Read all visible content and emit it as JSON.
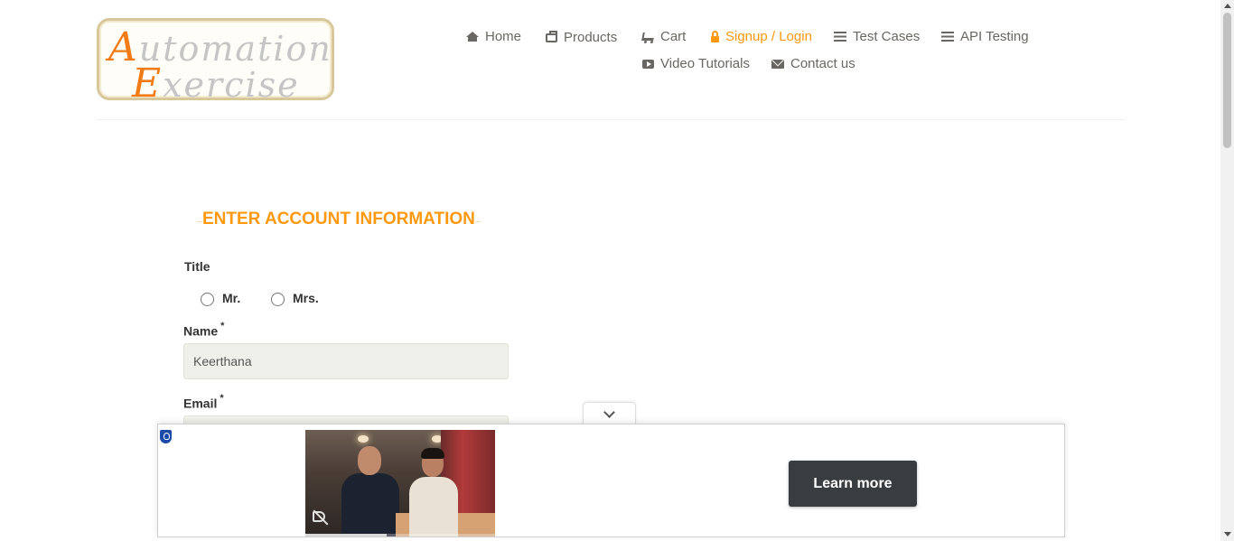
{
  "logo": {
    "line1_cap": "A",
    "line1_rest": "utomation",
    "line2_cap": "E",
    "line2_rest": "xercise"
  },
  "nav": {
    "home": "Home",
    "products": "Products",
    "cart": "Cart",
    "signup_login": "Signup / Login",
    "test_cases": "Test Cases",
    "api_testing": "API Testing",
    "video_tutorials": "Video Tutorials",
    "contact_us": "Contact us",
    "active_item": "signup_login",
    "accent_color": "#fe980f"
  },
  "form": {
    "section_title": "ENTER ACCOUNT INFORMATION",
    "title_label": "Title",
    "title_options": [
      "Mr.",
      "Mrs."
    ],
    "title_selected": "",
    "name_label": "Name",
    "required_mark": "*",
    "name_value": "Keerthana",
    "email_label": "Email",
    "email_value": ""
  },
  "ad": {
    "cta_label": "Learn more",
    "video_muted": true,
    "video_progress": 0.43
  }
}
